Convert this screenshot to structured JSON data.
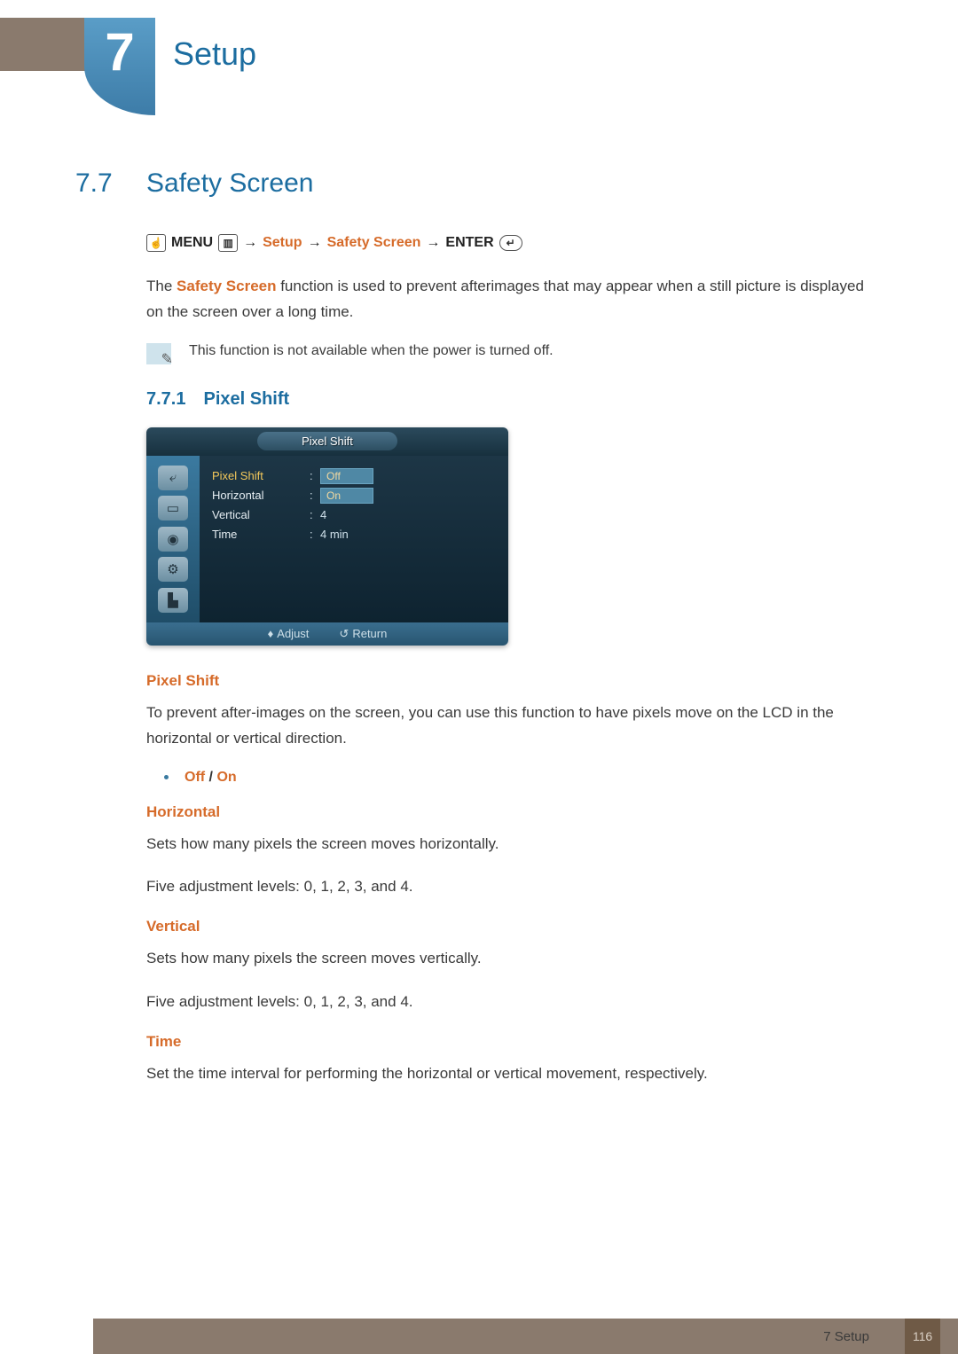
{
  "chapter": {
    "number": "7",
    "title": "Setup"
  },
  "section": {
    "number": "7.7",
    "title": "Safety Screen"
  },
  "navpath": {
    "menu": "MENU",
    "setup": "Setup",
    "safety": "Safety Screen",
    "enter": "ENTER"
  },
  "intro": {
    "prefix": "The ",
    "term": "Safety Screen",
    "rest": " function is used to prevent afterimages that may appear when a still picture is displayed on the screen over a long time."
  },
  "note": "This function is not available when the power is turned off.",
  "subsection": {
    "number": "7.7.1",
    "title": "Pixel Shift"
  },
  "osd": {
    "title": "Pixel Shift",
    "rows": {
      "pixel_shift": {
        "label": "Pixel Shift",
        "opt_off": "Off",
        "opt_on": "On"
      },
      "horizontal": {
        "label": "Horizontal"
      },
      "vertical": {
        "label": "Vertical",
        "value": "4"
      },
      "time": {
        "label": "Time",
        "value": "4 min"
      }
    },
    "footer": {
      "adjust": "Adjust",
      "return": "Return"
    }
  },
  "pixel_shift": {
    "heading": "Pixel Shift",
    "text": "To prevent after-images on the screen, you can use this function to have pixels move on the LCD in the horizontal or vertical direction.",
    "off": "Off",
    "sep": " / ",
    "on": "On"
  },
  "horizontal": {
    "heading": "Horizontal",
    "l1": "Sets how many pixels the screen moves horizontally.",
    "l2": "Five adjustment levels: 0, 1, 2, 3, and 4."
  },
  "vertical": {
    "heading": "Vertical",
    "l1": "Sets how many pixels the screen moves vertically.",
    "l2": "Five adjustment levels: 0, 1, 2, 3, and 4."
  },
  "time": {
    "heading": "Time",
    "l1": "Set the time interval for performing the horizontal or vertical movement, respectively."
  },
  "footer": {
    "label": "7 Setup",
    "page": "116"
  }
}
